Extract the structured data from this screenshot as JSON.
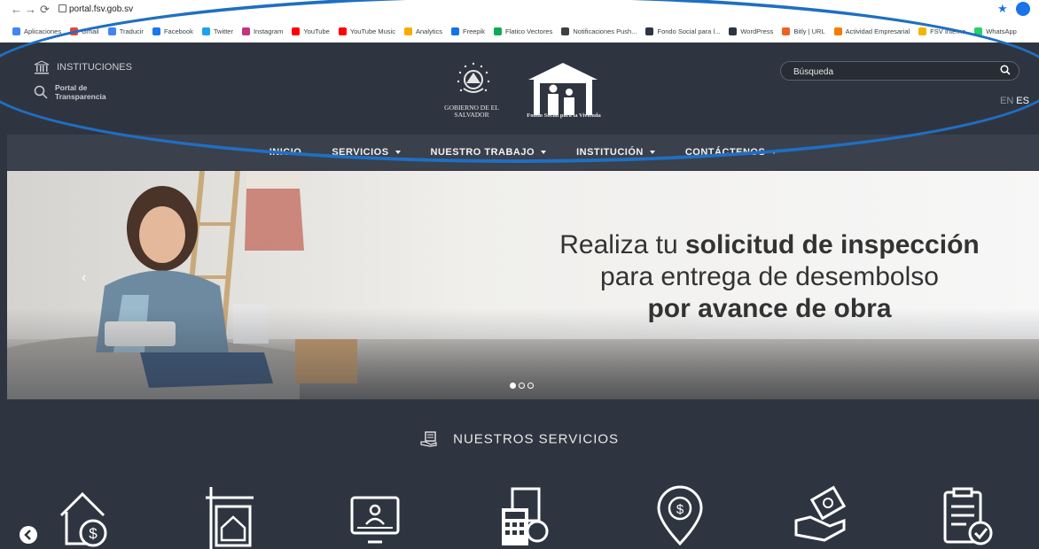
{
  "browser": {
    "url": "portal.fsv.gob.sv",
    "bookmarks": [
      {
        "label": "Aplicaciones",
        "color": "#4285f4"
      },
      {
        "label": "Gmail",
        "color": "#ea4335"
      },
      {
        "label": "Traducir",
        "color": "#4285f4"
      },
      {
        "label": "Facebook",
        "color": "#1877f2"
      },
      {
        "label": "Twitter",
        "color": "#1da1f2"
      },
      {
        "label": "Instagram",
        "color": "#c13584"
      },
      {
        "label": "YouTube",
        "color": "#ff0000"
      },
      {
        "label": "YouTube Music",
        "color": "#ff0000"
      },
      {
        "label": "Analytics",
        "color": "#f9ab00"
      },
      {
        "label": "Freepik",
        "color": "#1273eb"
      },
      {
        "label": "Flatico Vectores",
        "color": "#0fa958"
      },
      {
        "label": "Notificaciones Push...",
        "color": "#3c4043"
      },
      {
        "label": "Fondo Social para l...",
        "color": "#2f3540"
      },
      {
        "label": "WordPress",
        "color": "#2f3540"
      },
      {
        "label": "Bitly | URL",
        "color": "#ee6123"
      },
      {
        "label": "Actividad Empresarial",
        "color": "#f57c00"
      },
      {
        "label": "FSV Interno",
        "color": "#f4b400"
      },
      {
        "label": "WhatsApp",
        "color": "#25d366"
      }
    ]
  },
  "header": {
    "instituciones": "INSTITUCIONES",
    "transparencia": "Portal de Transparencia",
    "gobierno": "GOBIERNO DE EL SALVADOR",
    "fsv": "Fondo Social para la Vivienda",
    "search_placeholder": "Búsqueda",
    "lang_en": "EN",
    "lang_es": "ES"
  },
  "menu": [
    {
      "label": "INICIO",
      "dropdown": false
    },
    {
      "label": "SERVICIOS",
      "dropdown": true
    },
    {
      "label": "NUESTRO TRABAJO",
      "dropdown": true
    },
    {
      "label": "INSTITUCIÓN",
      "dropdown": true
    },
    {
      "label": "CONTÁCTENOS",
      "dropdown": true
    }
  ],
  "hero": {
    "line1_pre": "Realiza tu ",
    "line1_bold": "solicitud de inspección",
    "line2": "para entrega de desembolso",
    "line3": "por avance de obra",
    "slides": 3,
    "active_slide": 1
  },
  "services": {
    "title": "NUESTROS SERVICIOS",
    "icons": [
      "house-dollar-icon",
      "for-sale-sign-icon",
      "online-computer-icon",
      "calculator-document-icon",
      "location-pin-dollar-icon",
      "hand-money-icon",
      "checklist-icon"
    ]
  },
  "colors": {
    "header_bg": "#2f3540",
    "menu_bg": "#3a404c",
    "annotation": "#1f6fc2"
  }
}
